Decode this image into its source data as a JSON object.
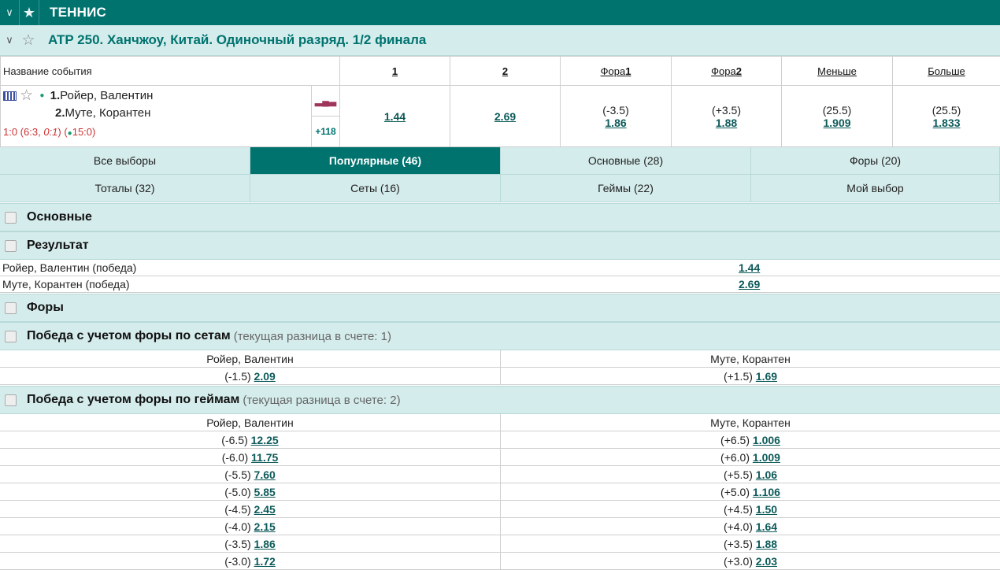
{
  "sport": {
    "title": "ТЕННИС"
  },
  "league": {
    "title": "ATP 250. Ханчжоу, Китай. Одиночный разряд. 1/2 финала"
  },
  "header": {
    "name": "Название события",
    "c1": "1",
    "c2": "2",
    "f1a": "Фора",
    "f1b": "1",
    "f2a": "Фора",
    "f2b": "2",
    "less": "Меньше",
    "more": "Больше"
  },
  "event": {
    "p1num": "1.",
    "p1": "Ройер, Валентин",
    "p2num": "2.",
    "p2": "Муте, Корантен",
    "score_a": "1:0 (6:3, ",
    "score_b": "0:1",
    "score_c": ") (",
    "score_d": "15:0)",
    "more_markets": "+118",
    "o1": "1.44",
    "o2": "2.69",
    "f1base": "(-3.5)",
    "f1": "1.86",
    "f2base": "(+3.5)",
    "f2": "1.88",
    "lbase": "(25.5)",
    "l": "1.909",
    "mbase": "(25.5)",
    "m": "1.833"
  },
  "filters": [
    {
      "label": "Все выборы"
    },
    {
      "label": "Популярные (46)"
    },
    {
      "label": "Основные (28)"
    },
    {
      "label": "Форы (20)"
    },
    {
      "label": "Тоталы (32)"
    },
    {
      "label": "Сеты (16)"
    },
    {
      "label": "Геймы (22)"
    },
    {
      "label": "Мой выбор"
    }
  ],
  "sections": {
    "main": "Основные",
    "result": "Результат",
    "handicaps": "Форы",
    "sets_hc": "Победа с учетом форы по сетам",
    "sets_hc_sub": "(текущая разница в счете: 1)",
    "games_hc": "Победа с учетом форы по геймам",
    "games_hc_sub": "(текущая разница в счете: 2)"
  },
  "result_rows": [
    {
      "name": "Ройер, Валентин (победа)",
      "odd": "1.44"
    },
    {
      "name": "Муте, Корантен (победа)",
      "odd": "2.69"
    }
  ],
  "sets": {
    "h1": "Ройер, Валентин",
    "h2": "Муте, Корантен",
    "b1": "(-1.5)",
    "o1": "2.09",
    "b2": "(+1.5)",
    "o2": "1.69"
  },
  "games": {
    "h1": "Ройер, Валентин",
    "h2": "Муте, Корантен",
    "rows": [
      {
        "b1": "(-6.5)",
        "o1": "12.25",
        "b2": "(+6.5)",
        "o2": "1.006"
      },
      {
        "b1": "(-6.0)",
        "o1": "11.75",
        "b2": "(+6.0)",
        "o2": "1.009"
      },
      {
        "b1": "(-5.5)",
        "o1": "7.60",
        "b2": "(+5.5)",
        "o2": "1.06"
      },
      {
        "b1": "(-5.0)",
        "o1": "5.85",
        "b2": "(+5.0)",
        "o2": "1.106"
      },
      {
        "b1": "(-4.5)",
        "o1": "2.45",
        "b2": "(+4.5)",
        "o2": "1.50"
      },
      {
        "b1": "(-4.0)",
        "o1": "2.15",
        "b2": "(+4.0)",
        "o2": "1.64"
      },
      {
        "b1": "(-3.5)",
        "o1": "1.86",
        "b2": "(+3.5)",
        "o2": "1.88"
      },
      {
        "b1": "(-3.0)",
        "o1": "1.72",
        "b2": "(+3.0)",
        "o2": "2.03"
      }
    ]
  }
}
